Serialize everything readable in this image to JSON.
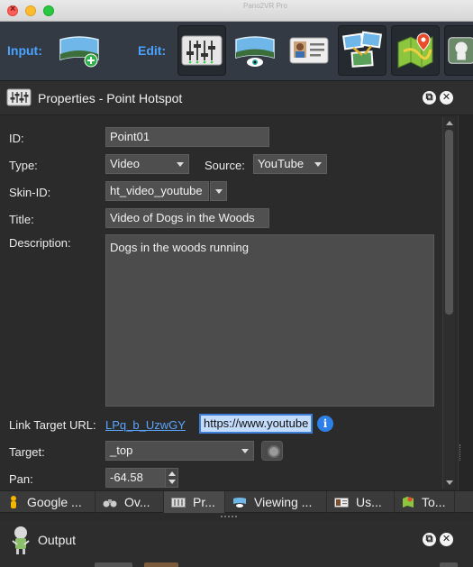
{
  "window": {
    "ghost_title": "Pano2VR Pro"
  },
  "toolbar": {
    "input_label": "Input:",
    "edit_label": "Edit:",
    "buttons": [
      {
        "icon": "add-panorama-icon"
      },
      {
        "icon": "sliders-icon",
        "active": true
      },
      {
        "icon": "view-panorama-icon"
      },
      {
        "icon": "id-card-icon"
      },
      {
        "icon": "tour-browser-icon"
      },
      {
        "icon": "map-pin-icon"
      },
      {
        "icon": "output-icon"
      }
    ]
  },
  "panel": {
    "title": "Properties - Point Hotspot",
    "float_label": "⧉",
    "close_label": "✕"
  },
  "properties": {
    "id_label": "ID:",
    "id_value": "Point01",
    "type_label": "Type:",
    "type_value": "Video",
    "source_label": "Source:",
    "source_value": "YouTube",
    "skin_label": "Skin-ID:",
    "skin_value": "ht_video_youtube",
    "title_label": "Title:",
    "title_value": "Video of Dogs in the Woods",
    "description_label": "Description:",
    "description_value": "Dogs in the woods running",
    "link_label": "Link Target URL:",
    "link_value": "LPq_b_UzwGY",
    "url_value": "https://www.youtube",
    "info_label": "i",
    "target_label": "Target:",
    "target_value": "_top",
    "pan_label": "Pan:",
    "pan_value": "-64.58"
  },
  "tabs": [
    {
      "label": "Google ...",
      "icon": "google-street-view-icon"
    },
    {
      "label": "Ov...",
      "icon": "binoculars-icon"
    },
    {
      "label": "Pr...",
      "icon": "properties-icon",
      "active": true
    },
    {
      "label": "Viewing ...",
      "icon": "viewing-parameters-icon"
    },
    {
      "label": "Us...",
      "icon": "user-data-icon"
    },
    {
      "label": "To...",
      "icon": "tour-icon"
    }
  ],
  "output": {
    "title": "Output",
    "float_label": "⧉",
    "close_label": "✕"
  },
  "colors": {
    "accent": "#4aa3ff",
    "link": "#5aa6ff",
    "panel_bg": "#2b2b2b",
    "toolbar_bg": "#333a44"
  }
}
